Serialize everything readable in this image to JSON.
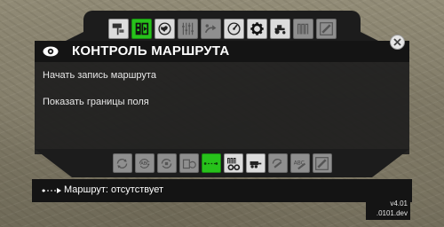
{
  "header": {
    "title": "КОНТРОЛЬ МАРШРУТА",
    "close_label": "✕"
  },
  "top_tabs": [
    {
      "icon": "route-sign-icon",
      "state": "normal"
    },
    {
      "icon": "field-record-icon",
      "state": "active"
    },
    {
      "icon": "globe-icon",
      "state": "normal"
    },
    {
      "icon": "sliders-icon",
      "state": "dim"
    },
    {
      "icon": "route-arrows-icon",
      "state": "dim"
    },
    {
      "icon": "gauge-icon",
      "state": "normal"
    },
    {
      "icon": "gear-icon",
      "state": "normal"
    },
    {
      "icon": "tractor-icon",
      "state": "normal"
    },
    {
      "icon": "swath-icon",
      "state": "dim"
    },
    {
      "icon": "edit-icon",
      "state": "dim"
    }
  ],
  "menu": {
    "items": [
      {
        "label": "Начать запись маршрута"
      },
      {
        "label": "Показать границы поля"
      }
    ]
  },
  "bottom_tabs": [
    {
      "icon": "cycle-icon",
      "state": "dim"
    },
    {
      "icon": "abc-cycle-icon",
      "state": "dim"
    },
    {
      "icon": "cycle-arrows-icon",
      "state": "dim"
    },
    {
      "icon": "field-cycle-icon",
      "state": "dim"
    },
    {
      "icon": "route-line-icon",
      "state": "active"
    },
    {
      "icon": "settings-swath-icon",
      "state": "normal"
    },
    {
      "icon": "trailer-icon",
      "state": "normal"
    },
    {
      "icon": "field-edit-icon",
      "state": "dim"
    },
    {
      "icon": "abc-edit-icon",
      "state": "dim"
    },
    {
      "icon": "edit-icon",
      "state": "dim"
    }
  ],
  "status": {
    "text": "Маршрут: отсутствует"
  },
  "version": {
    "line1": "v4.01",
    "line2": ".0101.dev"
  },
  "colors": {
    "active_tab": "#27c21b",
    "panel_bg": "#1e1e1e",
    "title_bar_bg": "#141414"
  }
}
